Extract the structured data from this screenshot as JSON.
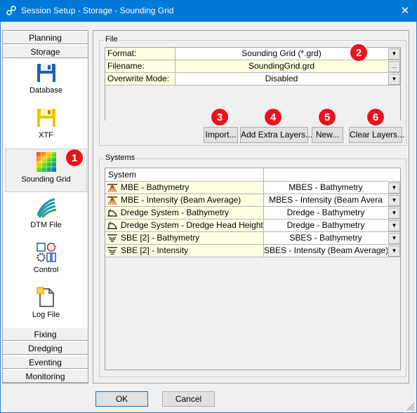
{
  "window": {
    "title": "Session Setup - Storage -  Sounding Grid",
    "close_glyph": "✕"
  },
  "nav": {
    "top_categories": [
      "Planning",
      "Storage"
    ],
    "items": [
      {
        "label": "Database",
        "icon": "floppy-disk-icon"
      },
      {
        "label": "XTF",
        "icon": "floppy-disk-yellow-icon"
      },
      {
        "label": "Sounding Grid",
        "icon": "sounding-grid-icon"
      },
      {
        "label": "DTM File",
        "icon": "dtm-file-icon"
      },
      {
        "label": "Control",
        "icon": "control-icon"
      },
      {
        "label": "Log File",
        "icon": "log-file-icon"
      }
    ],
    "bottom_categories": [
      "Fixing",
      "Dredging",
      "Eventing",
      "Monitoring"
    ]
  },
  "file": {
    "group_label": "File",
    "rows": [
      {
        "name": "Format:",
        "value": "Sounding Grid (*.grd)",
        "control": "▼"
      },
      {
        "name": "Filename:",
        "value": "SoundingGrid.grd",
        "control": "..."
      },
      {
        "name": "Overwrite Mode:",
        "value": "Disabled",
        "control": "▼"
      }
    ],
    "buttons": {
      "import": "Import...",
      "add_extra_layers": "Add Extra Layers...",
      "new": "New...",
      "clear_layers": "Clear Layers..."
    }
  },
  "systems": {
    "group_label": "Systems",
    "header": "System",
    "rows": [
      {
        "name": "MBE - Bathymetry",
        "value": "MBES - Bathymetry",
        "icon": "multibeam-icon"
      },
      {
        "name": "MBE - Intensity (Beam Average)",
        "value": "MBES - Intensity (Beam Avera",
        "icon": "multibeam-icon"
      },
      {
        "name": "Dredge System - Bathymetry",
        "value": "Dredge - Bathymetry",
        "icon": "dredge-icon"
      },
      {
        "name": "Dredge System - Dredge Head Height",
        "value": "Dredge - Bathymetry",
        "icon": "dredge-icon"
      },
      {
        "name": "SBE [2] - Bathymetry",
        "value": "SBES - Bathymetry",
        "icon": "singlebeam-icon"
      },
      {
        "name": "SBE [2] - Intensity",
        "value": "SBES - Intensity (Beam Average)",
        "icon": "singlebeam-icon"
      }
    ],
    "dropdown_glyph": "▼"
  },
  "badges": [
    "1",
    "2",
    "3",
    "4",
    "5",
    "6"
  ],
  "footer": {
    "ok": "OK",
    "cancel": "Cancel"
  },
  "colors": {
    "titlebar": "#0078d7",
    "badge": "#e8141b",
    "highlight": "#ffffe1"
  }
}
